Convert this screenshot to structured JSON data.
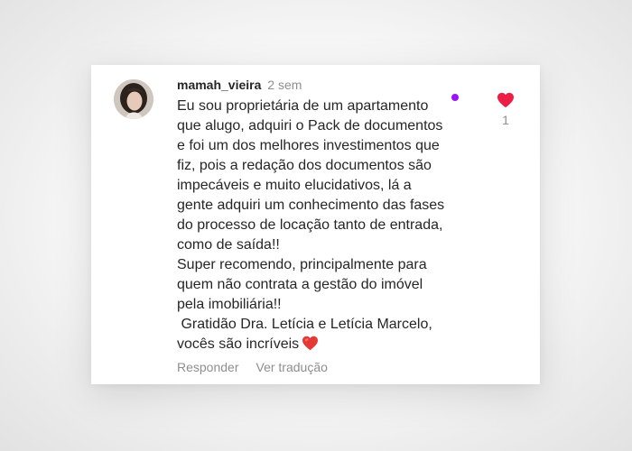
{
  "comment": {
    "username": "mamah_vieira",
    "time": "2 sem",
    "lines": [
      "Eu sou proprietária de um apartamento",
      "que alugo, adquiri o Pack de documentos",
      "e foi um dos melhores investimentos que",
      "fiz, pois a redação dos documentos são",
      "impecáveis e muito elucidativos, lá a",
      "gente adquiri um conhecimento das fases",
      "do processo de locação tanto de entrada,",
      "como de saída!!",
      "Super recomendo, principalmente para",
      "quem não contrata a gestão do imóvel",
      "pela imobiliária!!",
      " Gratidão Dra. Letícia e Letícia Marcelo,",
      "vocês são incríveis"
    ],
    "end_emoji": "red-heart-emoji",
    "like_count": "1",
    "liked": true
  },
  "actions": {
    "reply_label": "Responder",
    "translate_label": "Ver tradução"
  },
  "icons": {
    "like": "heart-icon",
    "unread": "purple-dot"
  },
  "colors": {
    "heart": "#ed1e46",
    "unread_dot": "#9a14f5",
    "username": "#262626",
    "secondary_text": "#8e8e8e"
  }
}
